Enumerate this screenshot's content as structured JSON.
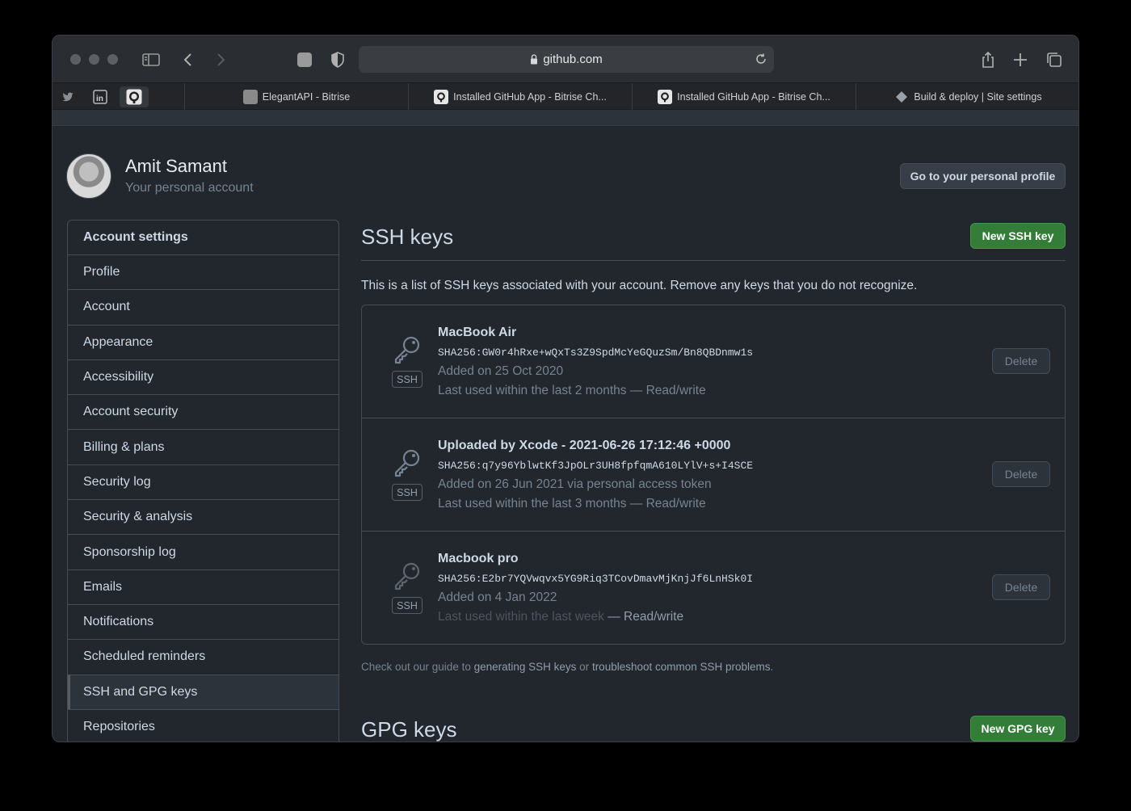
{
  "browser": {
    "url": "github.com",
    "pinned_tabs": [
      "twitter-icon",
      "linkedin-icon",
      "github-icon"
    ],
    "tabs": [
      {
        "label": "ElegantAPI - Bitrise",
        "icon": "bitrise-icon"
      },
      {
        "label": "Installed GitHub App - Bitrise Ch...",
        "icon": "github-icon"
      },
      {
        "label": "Installed GitHub App - Bitrise Ch...",
        "icon": "github-icon"
      },
      {
        "label": "Build & deploy | Site settings",
        "icon": "netlify-icon"
      }
    ]
  },
  "user": {
    "name": "Amit Samant",
    "subtitle": "Your personal account",
    "profile_button": "Go to your personal profile"
  },
  "sidebar": {
    "header": "Account settings",
    "items": [
      {
        "label": "Profile"
      },
      {
        "label": "Account"
      },
      {
        "label": "Appearance"
      },
      {
        "label": "Accessibility"
      },
      {
        "label": "Account security"
      },
      {
        "label": "Billing & plans"
      },
      {
        "label": "Security log"
      },
      {
        "label": "Security & analysis"
      },
      {
        "label": "Sponsorship log"
      },
      {
        "label": "Emails"
      },
      {
        "label": "Notifications"
      },
      {
        "label": "Scheduled reminders"
      },
      {
        "label": "SSH and GPG keys",
        "selected": true
      },
      {
        "label": "Repositories"
      }
    ]
  },
  "ssh": {
    "title": "SSH keys",
    "new_button": "New SSH key",
    "intro": "This is a list of SSH keys associated with your account. Remove any keys that you do not recognize.",
    "keys": [
      {
        "title": "MacBook Air",
        "fingerprint": "SHA256:GW0r4hRxe+wQxTs3Z9SpdMcYeGQuzSm/Bn8QBDnmw1s",
        "added": "Added on 25 Oct 2020",
        "last_used": "Last used within the last 2 months",
        "access": " — Read/write",
        "badge": "SSH",
        "delete": "Delete"
      },
      {
        "title": "Uploaded by Xcode - 2021-06-26 17:12:46 +0000",
        "fingerprint": "SHA256:q7y96YblwtKf3JpOLr3UH8fpfqmA610LYlV+s+I4SCE",
        "added": "Added on 26 Jun 2021 via personal access token",
        "last_used": "Last used within the last 3 months",
        "access": " — Read/write",
        "badge": "SSH",
        "delete": "Delete"
      },
      {
        "title": "Macbook pro",
        "fingerprint": "SHA256:E2br7YQVwqvx5YG9Riq3TCovDmavMjKnjJf6LnHSk0I",
        "added": "Added on 4 Jan 2022",
        "last_used": "Last used within the last week",
        "access": " — Read/write",
        "badge": "SSH",
        "delete": "Delete"
      }
    ],
    "guide": {
      "prefix": "Check out our guide to ",
      "link1": "generating SSH keys",
      "middle": " or ",
      "link2": "troubleshoot common SSH problems",
      "suffix": "."
    }
  },
  "gpg": {
    "title": "GPG keys",
    "new_button": "New GPG key"
  }
}
